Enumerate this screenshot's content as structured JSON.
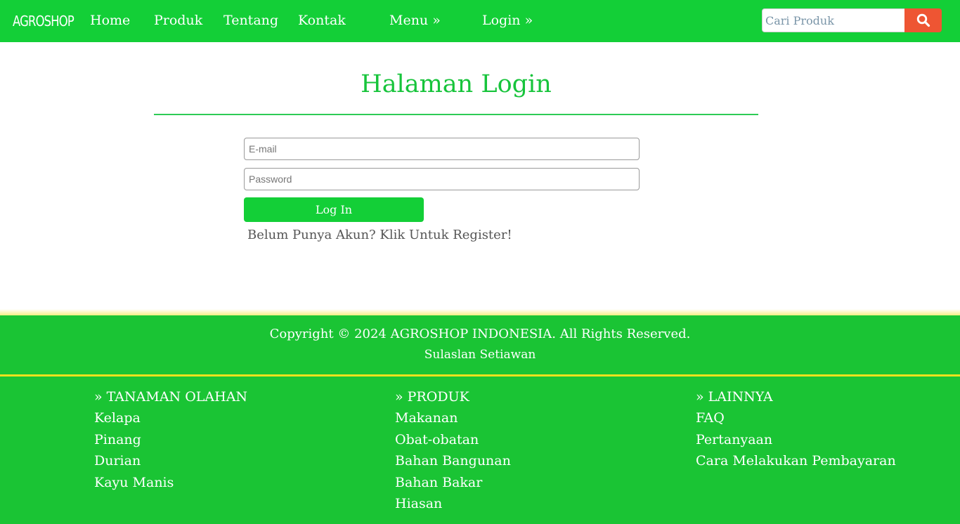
{
  "navbar": {
    "brand": "AGROSHOP",
    "links": [
      "Home",
      "Produk",
      "Tentang",
      "Kontak"
    ],
    "menu_label": "Menu »",
    "login_label": "Login »",
    "search": {
      "placeholder": "Cari Produk",
      "value": ""
    },
    "search_icon": "search-icon"
  },
  "main": {
    "title": "Halaman Login",
    "email_placeholder": "E-mail",
    "password_placeholder": "Password",
    "login_button": "Log In",
    "register_text": "Belum Punya Akun? Klik Untuk Register!"
  },
  "footer": {
    "copyright": "Copyright © 2024 AGROSHOP INDONESIA. All Rights Reserved.",
    "author": "Sulaslan Setiawan",
    "columns": [
      {
        "heading": "» TANAMAN OLAHAN",
        "links": [
          "Kelapa",
          "Pinang",
          "Durian",
          "Kayu Manis"
        ]
      },
      {
        "heading": "» PRODUK",
        "links": [
          "Makanan",
          "Obat-obatan",
          "Bahan Bangunan",
          "Bahan Bakar",
          "Hiasan"
        ]
      },
      {
        "heading": "» LAINNYA",
        "links": [
          "FAQ",
          "Pertanyaan",
          "Cara Melakukan Pembayaran"
        ]
      }
    ]
  },
  "colors": {
    "navbar": "#13cf37",
    "accent_title": "#17c43b",
    "search_button": "#ee5533",
    "footer": "#1ac434",
    "footer_divider": "#f0e21e"
  }
}
